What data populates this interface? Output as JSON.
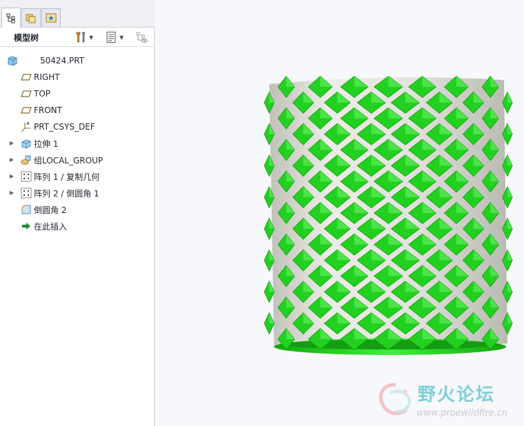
{
  "tabs": [
    {
      "name": "model-tree-tab",
      "icon": "model-tree-icon"
    },
    {
      "name": "folder-browser-tab",
      "icon": "folder-browser-icon"
    },
    {
      "name": "favorites-tab",
      "icon": "favorites-icon"
    }
  ],
  "header": {
    "title": "模型树",
    "tools": [
      "settings-icon",
      "show-icon",
      "filter-icon"
    ]
  },
  "tree": {
    "root": "50424.PRT",
    "items": [
      {
        "label": "RIGHT",
        "icon": "datum-plane-icon",
        "expandable": false
      },
      {
        "label": "TOP",
        "icon": "datum-plane-icon",
        "expandable": false
      },
      {
        "label": "FRONT",
        "icon": "datum-plane-icon",
        "expandable": false
      },
      {
        "label": "PRT_CSYS_DEF",
        "icon": "csys-icon",
        "expandable": false
      },
      {
        "label": "拉伸 1",
        "icon": "extrude-icon",
        "expandable": true
      },
      {
        "label": "组LOCAL_GROUP",
        "icon": "group-icon",
        "expandable": true
      },
      {
        "label": "阵列 1 / 复制几何",
        "icon": "pattern-icon",
        "expandable": true
      },
      {
        "label": "阵列 2 / 倒圆角 1",
        "icon": "pattern-icon",
        "expandable": true
      },
      {
        "label": "倒圆角 2",
        "icon": "round-icon",
        "expandable": false
      },
      {
        "label": "在此插入",
        "icon": "insert-here-icon",
        "expandable": false
      }
    ]
  },
  "watermark": {
    "title": "野火论坛",
    "url": "www.proewildfire.cn"
  },
  "colors": {
    "model_green": "#22d11f",
    "model_shell": "#d9dad3"
  }
}
